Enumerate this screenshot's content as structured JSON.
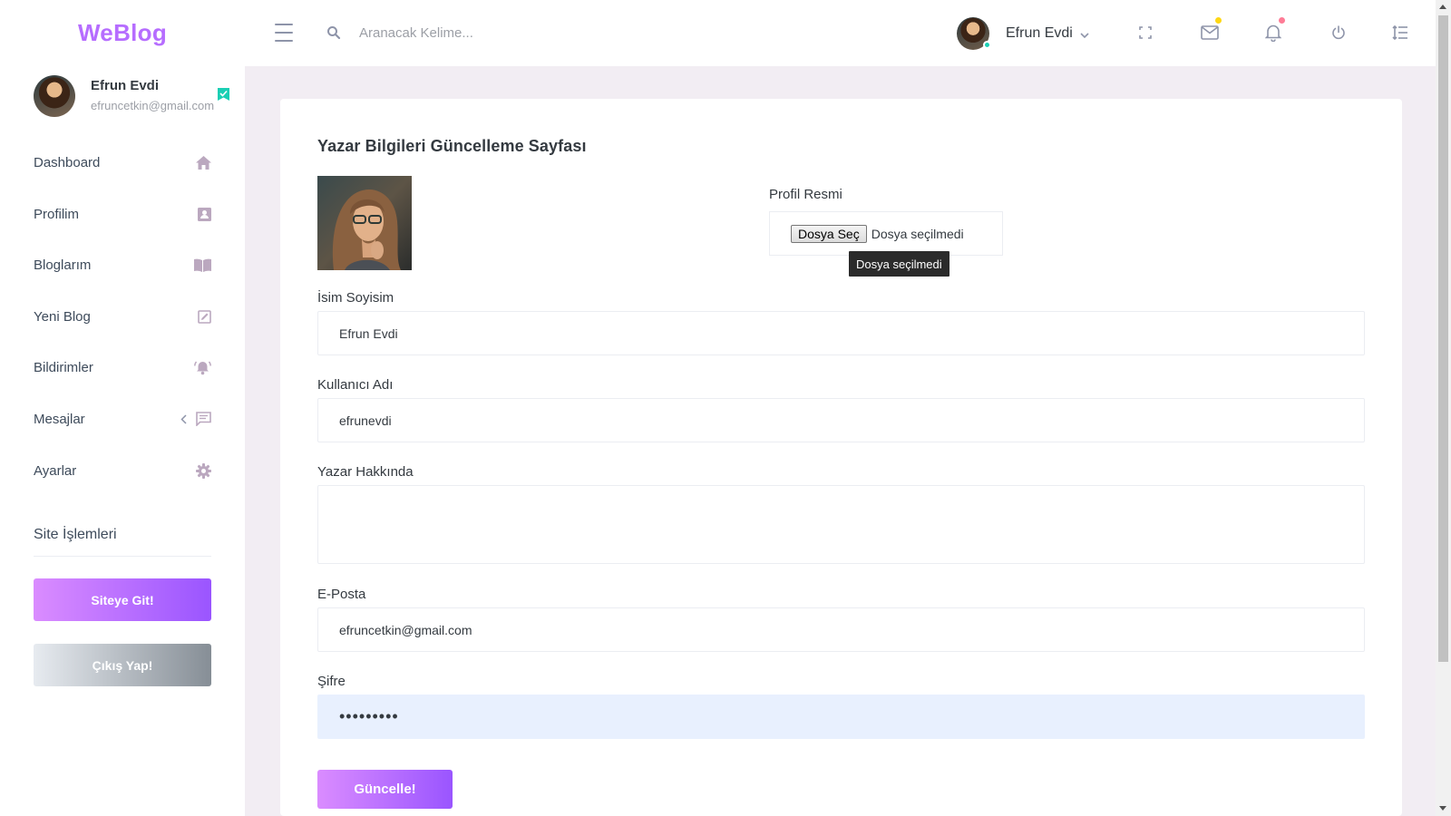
{
  "brand": {
    "name": "WeBlog",
    "color": "#b66dff"
  },
  "topbar": {
    "search_placeholder": "Aranacak Kelime...",
    "user_name": "Efrun Evdi",
    "icons": [
      "menu-icon",
      "search-icon",
      "fullscreen-icon",
      "mail-icon",
      "bell-icon",
      "power-icon",
      "format-list-icon"
    ],
    "mail_badge_color": "#fed713",
    "bell_badge_color": "#fe7c96"
  },
  "sidebar": {
    "profile": {
      "name": "Efrun Evdi",
      "email": "efruncetkin@gmail.com"
    },
    "items": [
      {
        "label": "Dashboard",
        "icon": "home-icon"
      },
      {
        "label": "Profilim",
        "icon": "contact-card-icon"
      },
      {
        "label": "Bloglarım",
        "icon": "book-icon"
      },
      {
        "label": "Yeni Blog",
        "icon": "edit-box-icon"
      },
      {
        "label": "Bildirimler",
        "icon": "bell-ring-icon"
      },
      {
        "label": "Mesajlar",
        "icon": "message-icon"
      },
      {
        "label": "Ayarlar",
        "icon": "gear-icon"
      }
    ],
    "section_title": "Site İşlemleri",
    "site_button": "Siteye Git!",
    "logout_button": "Çıkış Yap!"
  },
  "form": {
    "title": "Yazar Bilgileri Güncelleme Sayfası",
    "profile_image_label": "Profil Resmi",
    "file_button": "Dosya Seç",
    "file_status": "Dosya seçilmedi",
    "file_tooltip": "Dosya seçilmedi",
    "name_label": "İsim Soyisim",
    "name_value": "Efrun Evdi",
    "username_label": "Kullanıcı Adı",
    "username_value": "efrunevdi",
    "about_label": "Yazar Hakkında",
    "about_value": "",
    "email_label": "E-Posta",
    "email_value": "efruncetkin@gmail.com",
    "password_label": "Şifre",
    "password_value": "•••••••••",
    "submit_button": "Güncelle!"
  }
}
